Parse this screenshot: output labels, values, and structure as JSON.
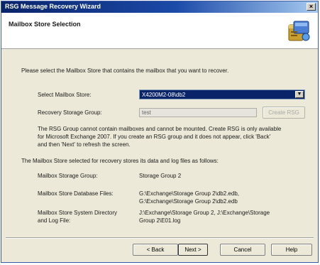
{
  "window": {
    "title": "RSG Message Recovery Wizard",
    "close_glyph": "×"
  },
  "header": {
    "title": "Mailbox Store Selection",
    "icon": "mailbox-store-icon"
  },
  "intro": "Please select the Mailbox Store that contains the mailbox that you want to recover.",
  "select_store": {
    "label": "Select Mailbox Store:",
    "value": "X4200M2-08\\db2"
  },
  "recovery_group": {
    "label": "Recovery Storage Group:",
    "value": "test",
    "create_button": "Create RSG"
  },
  "note": {
    "line1": "The RSG Group cannot contain mailboxes and cannot be mounted. Create RSG is only available",
    "line2": "for Microsoft Exchange 2007.  If you create an RSG group and it does not appear, click 'Back'",
    "line3": "and then 'Next' to refresh the screen."
  },
  "restore_intro": "The Mailbox Store selected for recovery stores its data and log files as follows:",
  "details": {
    "storage_group_label": "Mailbox Storage Group:",
    "storage_group_value": "Storage Group 2",
    "db_files_label": "Mailbox Store Database Files:",
    "db_files_line1": "G:\\Exchange\\Storage Group 2\\db2.edb,",
    "db_files_line2": "G:\\Exchange\\Storage Group 2\\db2.edb",
    "sysdir_label_line1": "Mailbox Store System Directory",
    "sysdir_label_line2": "and Log File:",
    "sysdir_line1": "J:\\Exchange\\Storage Group 2,  J:\\Exchange\\Storage",
    "sysdir_line2": "Group 2\\E01.log"
  },
  "buttons": {
    "back": "< Back",
    "next": "Next >",
    "cancel": "Cancel",
    "help": "Help"
  },
  "colors": {
    "titlebar": "#0a246a",
    "face": "#ece9d8",
    "selection": "#0a246a"
  }
}
